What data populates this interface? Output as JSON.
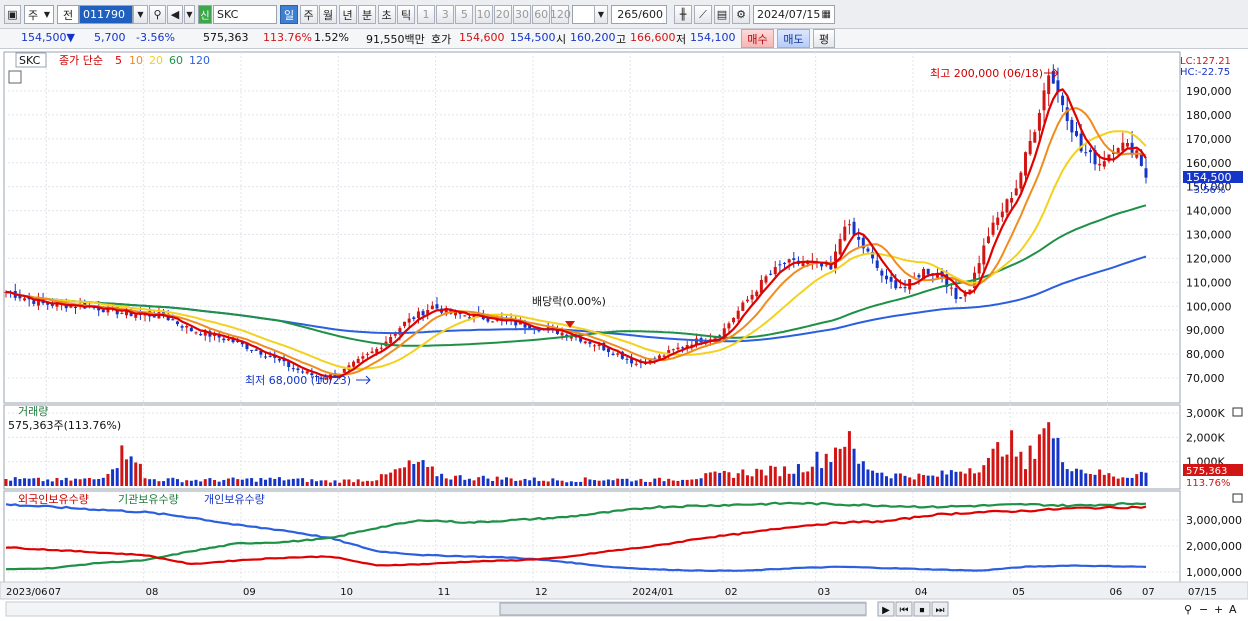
{
  "toolbar": {
    "market": "주",
    "period_type": "전",
    "code": "011790",
    "badge": "신",
    "name": "SKC",
    "tabs": [
      "일",
      "주",
      "월",
      "년",
      "분",
      "초",
      "틱"
    ],
    "active_tab": "일",
    "nums": [
      "1",
      "3",
      "5",
      "10",
      "20",
      "30",
      "60",
      "120"
    ],
    "count": "265",
    "count_max": "/600",
    "date": "2024/07/15"
  },
  "quote": {
    "price": "154,500▼",
    "change": "5,700",
    "rate": "-3.56%",
    "volume": "575,363",
    "vol_rate": "113.76%",
    "turnover": "1.52%",
    "amount": "91,550백만",
    "ask_label": "호가",
    "ask": "154,600",
    "bid": "154,500",
    "open_label": "시",
    "open": "160,200",
    "high_label": "고",
    "high": "166,600",
    "low_label": "저",
    "low": "154,100",
    "buy": "매수",
    "sell": "매도",
    "eval": "평"
  },
  "legend": {
    "name": "SKC",
    "ma_label": "종가 단순",
    "ma_periods": [
      "5",
      "10",
      "20",
      "60",
      "120"
    ]
  },
  "right": {
    "lc": "LC:127.21",
    "hc": "HC:-22.75",
    "price_box": "154,500",
    "pct": "-3.56%",
    "vol_box": "575,363",
    "vol_pct": "113.76%"
  },
  "annotations": {
    "high": "최고 200,000 (06/18)",
    "low": "최저 68,000 (10/23)",
    "dividend": "배당락(0.00%)"
  },
  "volume": {
    "title": "거래량",
    "info": "575,363주(113.76%)"
  },
  "holdings": {
    "foreign": "외국인보유수량",
    "inst": "기관보유수량",
    "indiv": "개인보유수량"
  },
  "colors": {
    "ma5": "#e00000",
    "ma10": "#f08c1e",
    "ma20": "#f3d21e",
    "ma60": "#1e9146",
    "ma120": "#2b5fe0",
    "up": "#d11515",
    "down": "#1535c8"
  },
  "price_axis": [
    "190,000",
    "180,000",
    "170,000",
    "160,000",
    "150,000",
    "140,000",
    "130,000",
    "120,000",
    "110,000",
    "100,000",
    "90,000",
    "80,000",
    "70,000"
  ],
  "volume_axis": [
    "3,000K",
    "2,000K",
    "1,000K"
  ],
  "hold_axis": [
    "3,000,000",
    "2,000,000",
    "1,000,000"
  ],
  "x_axis": [
    "2023/06",
    "07",
    "08",
    "09",
    "10",
    "11",
    "12",
    "2024/01",
    "02",
    "03",
    "04",
    "05",
    "06",
    "07"
  ],
  "x_axis_right": "07/15",
  "chart_data": {
    "type": "candlestick",
    "x": [
      "2023/06",
      "07",
      "08",
      "09",
      "10",
      "11",
      "12",
      "2024/01",
      "02",
      "03",
      "04",
      "05",
      "06",
      "07"
    ],
    "price_anchors": [
      [
        0,
        106000
      ],
      [
        8,
        101000
      ],
      [
        18,
        100000
      ],
      [
        26,
        97000
      ],
      [
        34,
        96000
      ],
      [
        40,
        90000
      ],
      [
        48,
        86000
      ],
      [
        56,
        80000
      ],
      [
        62,
        74000
      ],
      [
        68,
        70000
      ],
      [
        72,
        72000
      ],
      [
        80,
        82000
      ],
      [
        86,
        93000
      ],
      [
        92,
        100000
      ],
      [
        96,
        97000
      ],
      [
        104,
        95000
      ],
      [
        112,
        92000
      ],
      [
        120,
        89000
      ],
      [
        126,
        85000
      ],
      [
        132,
        80000
      ],
      [
        136,
        76000
      ],
      [
        140,
        78000
      ],
      [
        148,
        85000
      ],
      [
        154,
        88000
      ],
      [
        158,
        98000
      ],
      [
        164,
        112000
      ],
      [
        168,
        118000
      ],
      [
        174,
        118000
      ],
      [
        178,
        115000
      ],
      [
        181,
        135000
      ],
      [
        186,
        122000
      ],
      [
        190,
        110000
      ],
      [
        194,
        108000
      ],
      [
        198,
        115000
      ],
      [
        202,
        113000
      ],
      [
        205,
        103000
      ],
      [
        208,
        108000
      ],
      [
        212,
        130000
      ],
      [
        218,
        150000
      ],
      [
        222,
        175000
      ],
      [
        225,
        198000
      ],
      [
        228,
        185000
      ],
      [
        232,
        165000
      ],
      [
        236,
        160000
      ],
      [
        240,
        168000
      ],
      [
        244,
        165000
      ],
      [
        246,
        154500
      ]
    ],
    "volume_anchors": [
      [
        0,
        300
      ],
      [
        10,
        250
      ],
      [
        20,
        300
      ],
      [
        27,
        1800
      ],
      [
        30,
        300
      ],
      [
        40,
        250
      ],
      [
        60,
        300
      ],
      [
        70,
        200
      ],
      [
        80,
        300
      ],
      [
        89,
        1000
      ],
      [
        91,
        700
      ],
      [
        95,
        400
      ],
      [
        110,
        300
      ],
      [
        120,
        250
      ],
      [
        130,
        300
      ],
      [
        140,
        250
      ],
      [
        150,
        400
      ],
      [
        160,
        600
      ],
      [
        170,
        700
      ],
      [
        178,
        1400
      ],
      [
        181,
        2200
      ],
      [
        184,
        1000
      ],
      [
        190,
        500
      ],
      [
        200,
        400
      ],
      [
        212,
        1000
      ],
      [
        216,
        2100
      ],
      [
        220,
        800
      ],
      [
        224,
        2900
      ],
      [
        228,
        1200
      ],
      [
        232,
        700
      ],
      [
        240,
        400
      ],
      [
        246,
        575
      ]
    ],
    "foreign_hold": [
      [
        0,
        1950000
      ],
      [
        10,
        1850000
      ],
      [
        20,
        1750000
      ],
      [
        30,
        1650000
      ],
      [
        40,
        1300000
      ],
      [
        50,
        1450000
      ],
      [
        60,
        1550000
      ],
      [
        70,
        1600000
      ],
      [
        80,
        1250000
      ],
      [
        90,
        1300000
      ],
      [
        100,
        1400000
      ],
      [
        110,
        1450000
      ],
      [
        120,
        1550000
      ],
      [
        130,
        1800000
      ],
      [
        140,
        2000000
      ],
      [
        150,
        2300000
      ],
      [
        160,
        2500000
      ],
      [
        170,
        2750000
      ],
      [
        180,
        2900000
      ],
      [
        190,
        2950000
      ],
      [
        200,
        3200000
      ],
      [
        210,
        3300000
      ],
      [
        220,
        3350000
      ],
      [
        230,
        3450000
      ],
      [
        246,
        3500000
      ]
    ],
    "inst_hold": [
      [
        0,
        1100000
      ],
      [
        10,
        1150000
      ],
      [
        20,
        1350000
      ],
      [
        30,
        1450000
      ],
      [
        40,
        1800000
      ],
      [
        50,
        2100000
      ],
      [
        60,
        2150000
      ],
      [
        70,
        2300000
      ],
      [
        80,
        2700000
      ],
      [
        90,
        3000000
      ],
      [
        100,
        2900000
      ],
      [
        110,
        3000000
      ],
      [
        120,
        3100000
      ],
      [
        130,
        3300000
      ],
      [
        140,
        3500000
      ],
      [
        150,
        3550000
      ],
      [
        160,
        3600000
      ],
      [
        170,
        3650000
      ],
      [
        180,
        3600000
      ],
      [
        190,
        3550000
      ],
      [
        200,
        3500000
      ],
      [
        210,
        3550000
      ],
      [
        220,
        3600000
      ],
      [
        230,
        3550000
      ],
      [
        246,
        3650000
      ]
    ],
    "indiv_hold": [
      [
        0,
        3600000
      ],
      [
        10,
        3500000
      ],
      [
        20,
        3400000
      ],
      [
        30,
        3300000
      ],
      [
        40,
        3100000
      ],
      [
        50,
        2800000
      ],
      [
        60,
        2600000
      ],
      [
        70,
        2300000
      ],
      [
        80,
        1800000
      ],
      [
        90,
        1650000
      ],
      [
        100,
        1600000
      ],
      [
        110,
        1550000
      ],
      [
        120,
        1400000
      ],
      [
        130,
        1200000
      ],
      [
        140,
        1100000
      ],
      [
        150,
        1050000
      ],
      [
        160,
        1050000
      ],
      [
        170,
        1150000
      ],
      [
        180,
        1200000
      ],
      [
        190,
        1150000
      ],
      [
        200,
        1100000
      ],
      [
        210,
        1050000
      ],
      [
        220,
        1200000
      ],
      [
        230,
        1250000
      ],
      [
        246,
        1200000
      ]
    ]
  }
}
